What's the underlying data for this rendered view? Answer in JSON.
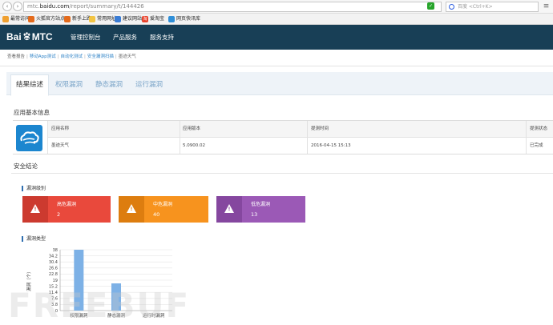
{
  "browser": {
    "url_prefix": "mtc.",
    "url_domain": "baidu.com",
    "url_path": "/report/summary/t/144426",
    "search_placeholder": "百度 <Ctrl+K>",
    "bookmarks": [
      {
        "label": "最常访问",
        "icon": "star-icon",
        "color": "#f0a030"
      },
      {
        "label": "火狐官方站点",
        "icon": "firefox-icon",
        "color": "#e46a1b"
      },
      {
        "label": "新手上路",
        "icon": "firefox-icon",
        "color": "#e46a1b"
      },
      {
        "label": "常用网址",
        "icon": "folder-icon",
        "color": "#f2c443"
      },
      {
        "label": "建议网站",
        "icon": "suggest-icon",
        "color": "#3a7dd6"
      },
      {
        "label": "爱淘宝",
        "icon": "taobao-icon",
        "color": "#e8412a",
        "icon_text": "淘"
      },
      {
        "label": "网页快讯库",
        "icon": "web-slice-icon",
        "color": "#2f8fd8"
      }
    ]
  },
  "header": {
    "logo_left": "Bai",
    "logo_right": "MTC",
    "nav": [
      "管理控制台",
      "产品服务",
      "服务支持"
    ]
  },
  "breadcrumb": [
    "查看报告",
    "移动App测试",
    "自动化测试",
    "安全漏洞扫描",
    "墨迹天气"
  ],
  "tabs": [
    "结果综述",
    "权限漏洞",
    "静态漏洞",
    "运行漏洞"
  ],
  "app_info": {
    "section_title": "应用基本信息",
    "headers": [
      "应用名称",
      "应用版本",
      "提测时间",
      "提测状态"
    ],
    "row": [
      "墨迹天气",
      "5.0900.02",
      "2016-04-15 15:13",
      "已完成"
    ]
  },
  "security": {
    "section_title": "安全结论",
    "level_title": "漏洞级别",
    "cards": [
      {
        "label": "高危漏洞",
        "value": "2",
        "color": "#e9493c",
        "icon_color": "#cc3a2f"
      },
      {
        "label": "中危漏洞",
        "value": "40",
        "color": "#f7931e",
        "icon_color": "#dd7d0f"
      },
      {
        "label": "低危漏洞",
        "value": "13",
        "color": "#9b59b6",
        "icon_color": "#85479f"
      }
    ],
    "type_title": "漏洞类型"
  },
  "chart_data": {
    "type": "bar",
    "ylabel": "漏洞（个）",
    "categories": [
      "权限漏洞",
      "静态漏洞",
      "运行时漏洞"
    ],
    "values": [
      38,
      17,
      0
    ],
    "yticks": [
      "38",
      "34.2",
      "30.4",
      "26.6",
      "22.8",
      "19",
      "15.2",
      "11.4",
      "7.6",
      "3.8",
      "0"
    ],
    "ylim": [
      0,
      38
    ],
    "bar_color": "#7db1e6",
    "grid": true
  },
  "watermark": "FREEBUF"
}
